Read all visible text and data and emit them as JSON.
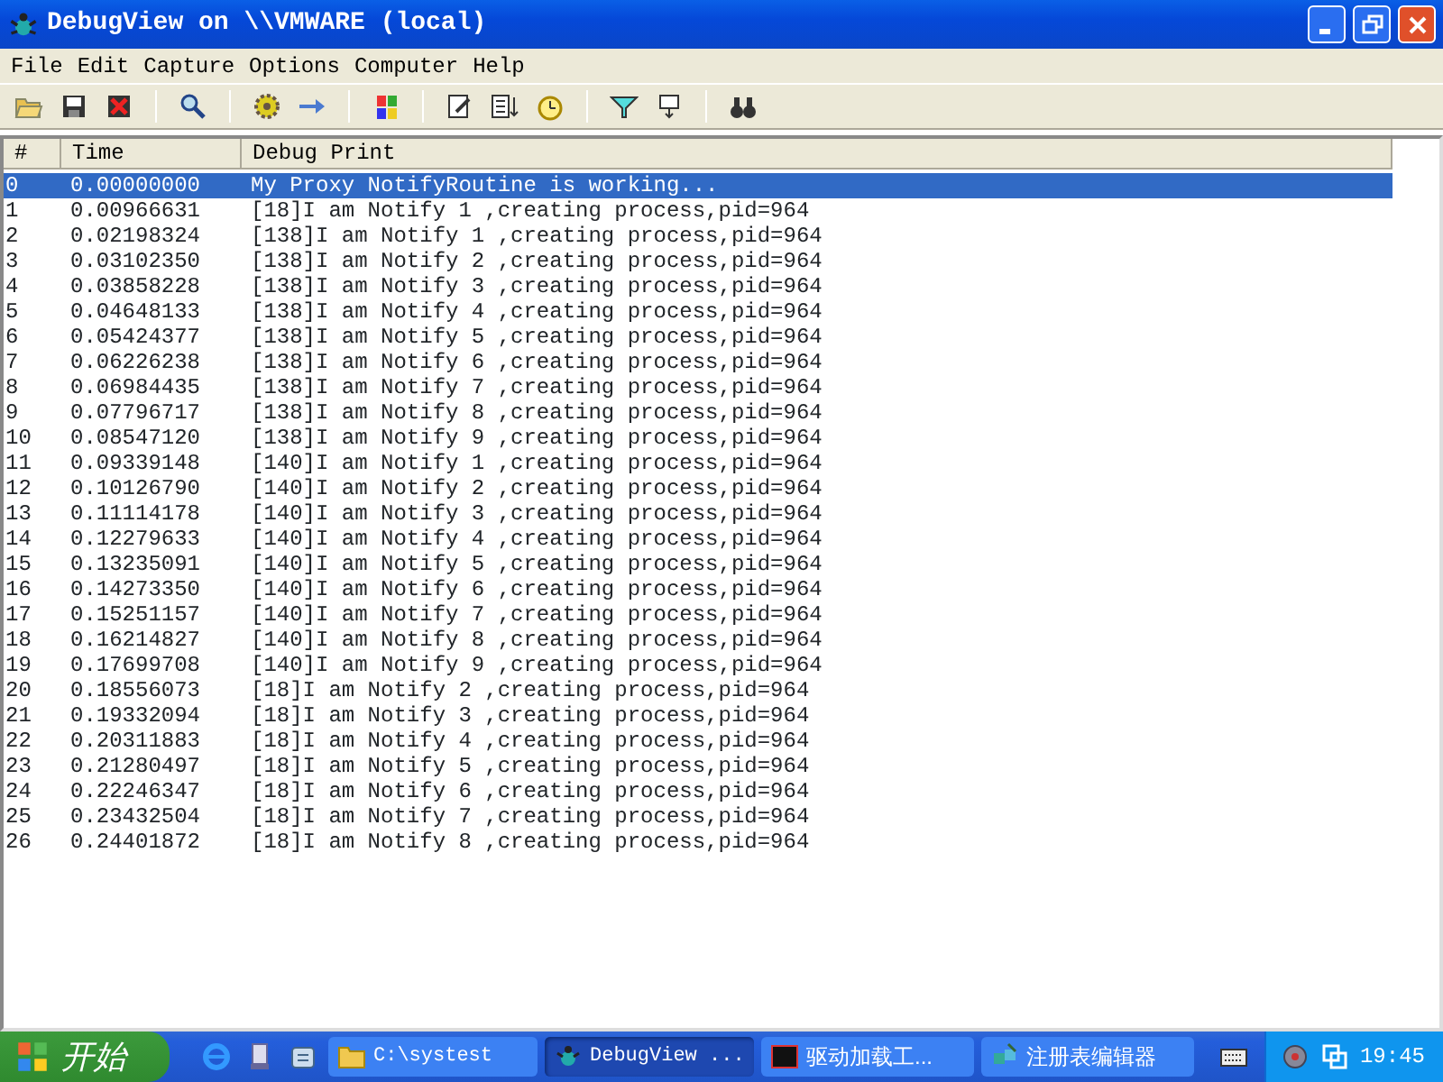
{
  "window": {
    "title": "DebugView on \\\\VMWARE (local)"
  },
  "menu": [
    "File",
    "Edit",
    "Capture",
    "Options",
    "Computer",
    "Help"
  ],
  "toolbar": [
    {
      "kind": "open"
    },
    {
      "kind": "save"
    },
    {
      "kind": "clear"
    },
    {
      "kind": "sep"
    },
    {
      "kind": "find"
    },
    {
      "kind": "sep"
    },
    {
      "kind": "capture"
    },
    {
      "kind": "passthrough"
    },
    {
      "kind": "sep"
    },
    {
      "kind": "capture-win"
    },
    {
      "kind": "sep"
    },
    {
      "kind": "edit"
    },
    {
      "kind": "autoscroll"
    },
    {
      "kind": "clock"
    },
    {
      "kind": "sep"
    },
    {
      "kind": "filter"
    },
    {
      "kind": "highlight"
    },
    {
      "kind": "sep"
    },
    {
      "kind": "search"
    }
  ],
  "table": {
    "columns": [
      "#",
      "Time",
      "Debug Print"
    ],
    "rows": [
      {
        "index": "0",
        "time": "0.00000000",
        "text": "My Proxy NotifyRoutine is working...",
        "selected": true
      },
      {
        "index": "1",
        "time": "0.00966631",
        "text": "[18]I am Notify 1 ,creating process,pid=964",
        "selected": false
      },
      {
        "index": "2",
        "time": "0.02198324",
        "text": "[138]I am Notify 1 ,creating process,pid=964",
        "selected": false
      },
      {
        "index": "3",
        "time": "0.03102350",
        "text": "[138]I am Notify 2 ,creating process,pid=964",
        "selected": false
      },
      {
        "index": "4",
        "time": "0.03858228",
        "text": "[138]I am Notify 3 ,creating process,pid=964",
        "selected": false
      },
      {
        "index": "5",
        "time": "0.04648133",
        "text": "[138]I am Notify 4 ,creating process,pid=964",
        "selected": false
      },
      {
        "index": "6",
        "time": "0.05424377",
        "text": "[138]I am Notify 5 ,creating process,pid=964",
        "selected": false
      },
      {
        "index": "7",
        "time": "0.06226238",
        "text": "[138]I am Notify 6 ,creating process,pid=964",
        "selected": false
      },
      {
        "index": "8",
        "time": "0.06984435",
        "text": "[138]I am Notify 7 ,creating process,pid=964",
        "selected": false
      },
      {
        "index": "9",
        "time": "0.07796717",
        "text": "[138]I am Notify 8 ,creating process,pid=964",
        "selected": false
      },
      {
        "index": "10",
        "time": "0.08547120",
        "text": "[138]I am Notify 9 ,creating process,pid=964",
        "selected": false
      },
      {
        "index": "11",
        "time": "0.09339148",
        "text": "[140]I am Notify 1 ,creating process,pid=964",
        "selected": false
      },
      {
        "index": "12",
        "time": "0.10126790",
        "text": "[140]I am Notify 2 ,creating process,pid=964",
        "selected": false
      },
      {
        "index": "13",
        "time": "0.11114178",
        "text": "[140]I am Notify 3 ,creating process,pid=964",
        "selected": false
      },
      {
        "index": "14",
        "time": "0.12279633",
        "text": "[140]I am Notify 4 ,creating process,pid=964",
        "selected": false
      },
      {
        "index": "15",
        "time": "0.13235091",
        "text": "[140]I am Notify 5 ,creating process,pid=964",
        "selected": false
      },
      {
        "index": "16",
        "time": "0.14273350",
        "text": "[140]I am Notify 6 ,creating process,pid=964",
        "selected": false
      },
      {
        "index": "17",
        "time": "0.15251157",
        "text": "[140]I am Notify 7 ,creating process,pid=964",
        "selected": false
      },
      {
        "index": "18",
        "time": "0.16214827",
        "text": "[140]I am Notify 8 ,creating process,pid=964",
        "selected": false
      },
      {
        "index": "19",
        "time": "0.17699708",
        "text": "[140]I am Notify 9 ,creating process,pid=964",
        "selected": false
      },
      {
        "index": "20",
        "time": "0.18556073",
        "text": "[18]I am Notify 2 ,creating process,pid=964",
        "selected": false
      },
      {
        "index": "21",
        "time": "0.19332094",
        "text": "[18]I am Notify 3 ,creating process,pid=964",
        "selected": false
      },
      {
        "index": "22",
        "time": "0.20311883",
        "text": "[18]I am Notify 4 ,creating process,pid=964",
        "selected": false
      },
      {
        "index": "23",
        "time": "0.21280497",
        "text": "[18]I am Notify 5 ,creating process,pid=964",
        "selected": false
      },
      {
        "index": "24",
        "time": "0.22246347",
        "text": "[18]I am Notify 6 ,creating process,pid=964",
        "selected": false
      },
      {
        "index": "25",
        "time": "0.23432504",
        "text": "[18]I am Notify 7 ,creating process,pid=964",
        "selected": false
      },
      {
        "index": "26",
        "time": "0.24401872",
        "text": "[18]I am Notify 8 ,creating process,pid=964",
        "selected": false
      }
    ]
  },
  "taskbar": {
    "start": "开始",
    "tasks": [
      {
        "kind": "folder",
        "label": "C:\\systest",
        "selected": false
      },
      {
        "kind": "bug",
        "label": "DebugView ...",
        "selected": true
      },
      {
        "kind": "sys",
        "label": "驱动加载工...",
        "selected": false
      },
      {
        "kind": "regedit",
        "label": "注册表编辑器",
        "selected": false
      }
    ],
    "clock": "19:45"
  }
}
